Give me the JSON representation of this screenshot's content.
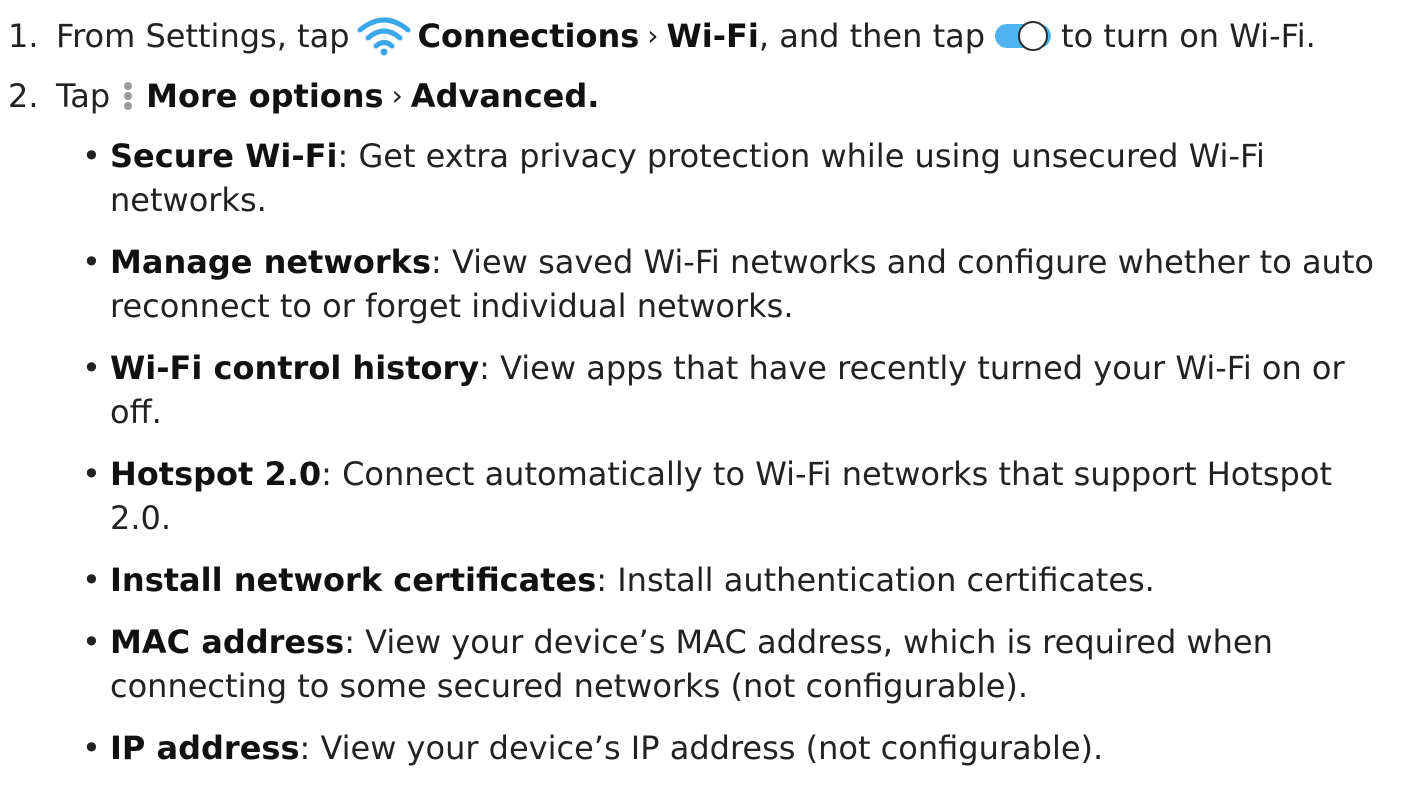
{
  "steps": [
    {
      "number": "1.",
      "parts": {
        "prefix": "From Settings, tap",
        "connections": "Connections",
        "chevron": "›",
        "wifi": "Wi-Fi",
        "middle": ", and then tap",
        "suffix": "to turn on Wi-Fi."
      },
      "icons": [
        "wifi-icon",
        "toggle-icon"
      ]
    },
    {
      "number": "2.",
      "parts": {
        "prefix": "Tap",
        "more_options": "More options",
        "chevron": "›",
        "advanced": "Advanced."
      },
      "icons": [
        "more-options-icon"
      ]
    }
  ],
  "bullets": [
    {
      "term": "Secure Wi-Fi",
      "desc": ": Get extra privacy protection while using unsecured Wi-Fi networks."
    },
    {
      "term": "Manage networks",
      "desc": ": View saved Wi-Fi networks and configure whether to auto reconnect to or forget individual networks."
    },
    {
      "term": "Wi-Fi control history",
      "desc": ": View apps that have recently turned your Wi-Fi on or off."
    },
    {
      "term": "Hotspot 2.0",
      "desc": ": Connect automatically to Wi-Fi networks that support Hotspot 2.0."
    },
    {
      "term": "Install network certificates",
      "desc": ": Install authentication certificates."
    },
    {
      "term": "MAC address",
      "desc": ": View your device’s MAC address, which is required when connecting to some secured networks (not configurable)."
    },
    {
      "term": "IP address",
      "desc": ": View your device’s IP address (not configurable)."
    }
  ],
  "colors": {
    "accent": "#3aa7ea",
    "toggle_track": "#4fb3ee",
    "more_dots": "#9a9a9a"
  }
}
